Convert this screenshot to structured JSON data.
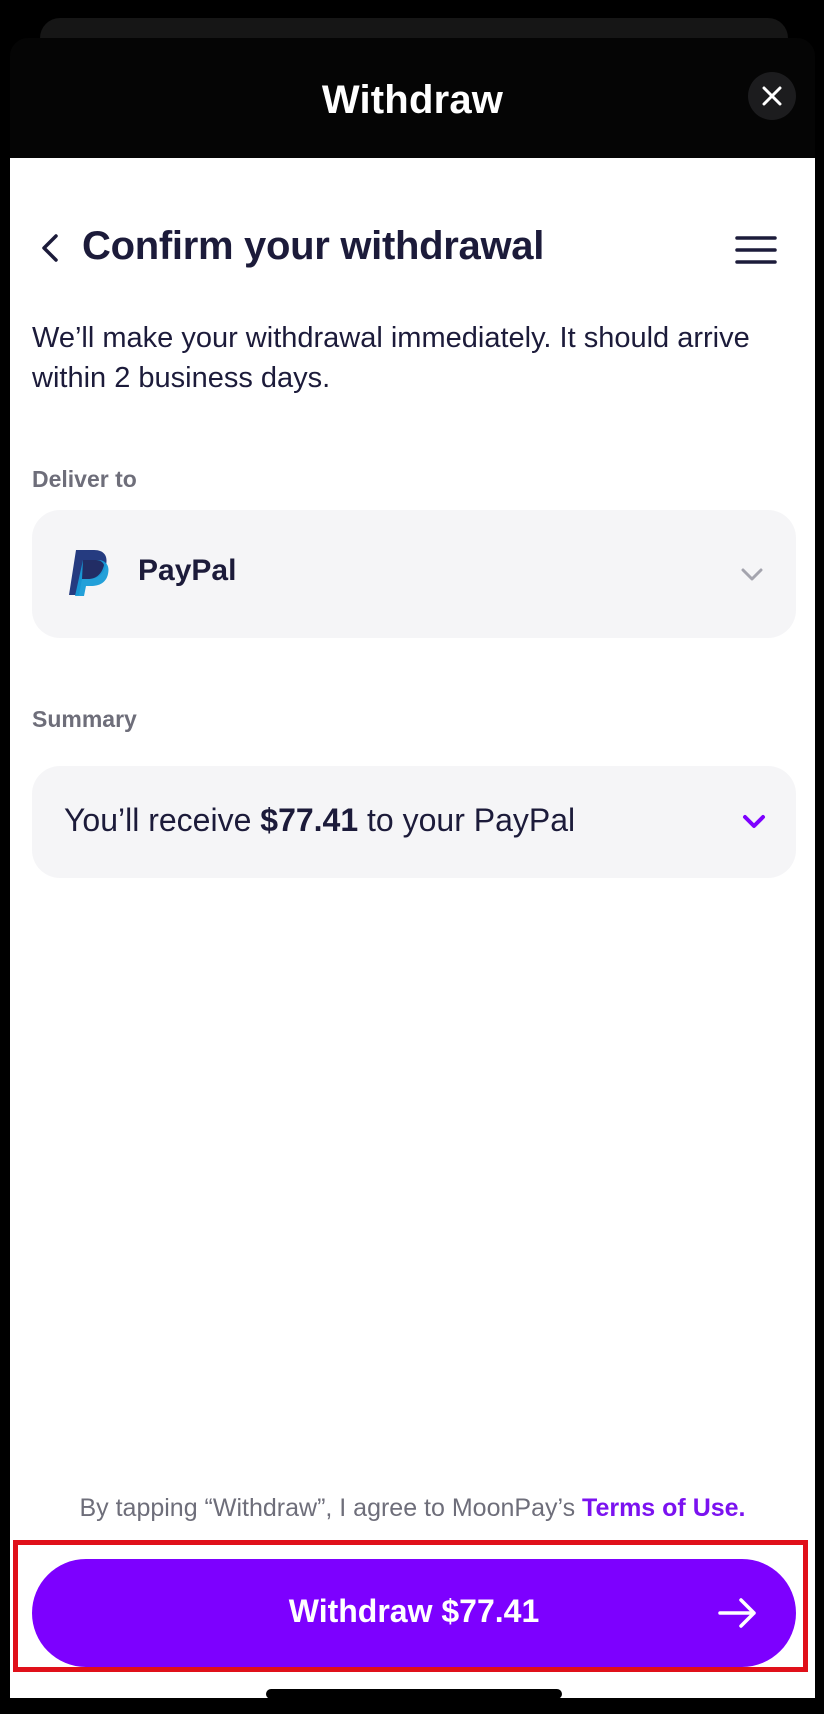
{
  "modal": {
    "title": "Withdraw",
    "close_icon": "close-icon"
  },
  "page": {
    "title": "Confirm your withdrawal",
    "back_icon": "chevron-left-icon",
    "menu_icon": "hamburger-menu-icon",
    "intro": "We’ll make your withdrawal immediately. It should arrive within 2 business days."
  },
  "delivery": {
    "label": "Deliver to",
    "method": "PayPal",
    "method_icon": "paypal-logo-icon",
    "chevron_icon": "chevron-down-icon"
  },
  "summary": {
    "label": "Summary",
    "prefix": "You’ll receive ",
    "amount": "$77.41",
    "suffix": " to your PayPal",
    "chevron_icon": "chevron-down-icon"
  },
  "terms": {
    "text": "By tapping “Withdraw”, I agree to MoonPay’s ",
    "link": "Terms of Use."
  },
  "primary_action": {
    "label": "Withdraw $77.41",
    "icon": "arrow-right-icon"
  },
  "colors": {
    "accent": "#7d00ff",
    "link": "#7b12f0",
    "text": "#1c1b3a",
    "muted": "#6e6e7a",
    "card": "#f5f5f7",
    "highlight": "#e0101a"
  }
}
